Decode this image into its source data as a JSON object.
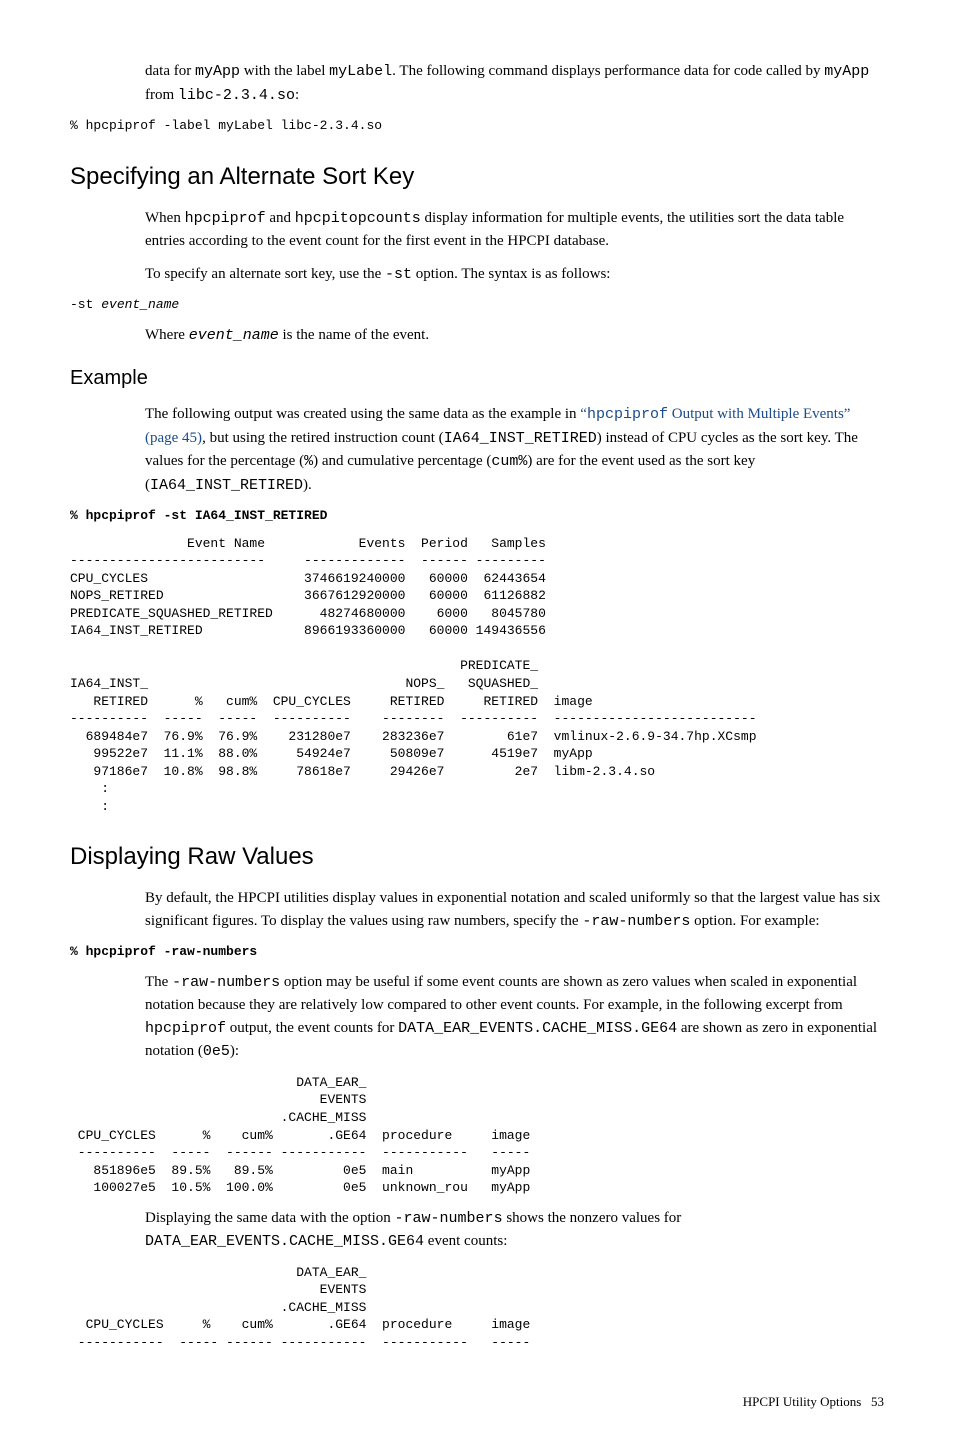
{
  "intro": {
    "p1_a": "data for ",
    "p1_b": "myApp",
    "p1_c": " with the label ",
    "p1_d": "myLabel",
    "p1_e": ". The following command displays performance data for code called by ",
    "p1_f": "myApp",
    "p1_g": " from ",
    "p1_h": "libc-2.3.4.so",
    "p1_i": ":",
    "code1": "% hpcpiprof -label myLabel libc-2.3.4.so"
  },
  "sortkey": {
    "heading": "Specifying an Alternate Sort Key",
    "p1_a": "When ",
    "p1_b": "hpcpiprof",
    "p1_c": " and ",
    "p1_d": "hpcpitopcounts",
    "p1_e": " display information for multiple events, the utilities sort the data table entries according to the event count for the first event in the HPCPI database.",
    "p2_a": "To specify an alternate sort key, use the ",
    "p2_b": "-st",
    "p2_c": " option. The syntax is as follows:",
    "code_a": "-st ",
    "code_b": "event_name",
    "p3_a": "Where ",
    "p3_b": "event_name",
    "p3_c": " is the name of the event."
  },
  "example": {
    "heading": "Example",
    "p1_a": "The following output was created using the same data as the example in ",
    "p1_link_a": "“",
    "p1_link_b": "hpcpiprof",
    "p1_link_c": " Output with Multiple Events” (page 45)",
    "p1_b": ", but using the retired instruction count (",
    "p1_c": "IA64_INST_RETIRED",
    "p1_d": ") instead of CPU cycles as the sort key. The values for the percentage (",
    "p1_e": "%",
    "p1_f": ") and cumulative percentage (",
    "p1_g": "cum%",
    "p1_h": ") are for the event used as the sort key (",
    "p1_i": "IA64_INST_RETIRED",
    "p1_j": ").",
    "cmd": "% hpcpiprof -st IA64_INST_RETIRED",
    "out": "               Event Name            Events  Period   Samples\n-------------------------     -------------  ------ ---------\nCPU_CYCLES                    3746619240000   60000  62443654\nNOPS_RETIRED                  3667612920000   60000  61126882\nPREDICATE_SQUASHED_RETIRED      48274680000    6000   8045780\nIA64_INST_RETIRED             8966193360000   60000 149436556\n\n                                                  PREDICATE_\nIA64_INST_                                 NOPS_   SQUASHED_\n   RETIRED      %   cum%  CPU_CYCLES     RETIRED     RETIRED  image\n----------  -----  -----  ----------    --------  ----------  --------------------------\n  689484e7  76.9%  76.9%    231280e7    283236e7        61e7  vmlinux-2.6.9-34.7hp.XCsmp\n   99522e7  11.1%  88.0%     54924e7     50809e7      4519e7  myApp\n   97186e7  10.8%  98.8%     78618e7     29426e7         2e7  libm-2.3.4.so\n    :\n    :"
  },
  "raw": {
    "heading": "Displaying Raw Values",
    "p1_a": "By default, the HPCPI utilities display values in exponential notation and scaled uniformly so that the largest value has six significant figures. To display the values using raw numbers, specify the ",
    "p1_b": "-raw-numbers",
    "p1_c": " option. For example:",
    "cmd": "% hpcpiprof -raw-numbers",
    "p2_a": "The ",
    "p2_b": "-raw-numbers",
    "p2_c": " option may be useful if some event counts are shown as zero values when scaled in exponential notation because they are relatively low compared to other event counts. For example, in the following excerpt from ",
    "p2_d": "hpcpiprof",
    "p2_e": " output, the event counts for ",
    "p2_f": "DATA_EAR_EVENTS.CACHE_MISS.GE64",
    "p2_g": " are shown as zero in exponential notation (",
    "p2_h": "0e5",
    "p2_i": "):",
    "out1": "                             DATA_EAR_\n                                EVENTS\n                           .CACHE_MISS\n CPU_CYCLES      %    cum%       .GE64  procedure     image\n ----------  -----  ------ -----------  -----------   -----\n   851896e5  89.5%   89.5%         0e5  main          myApp\n   100027e5  10.5%  100.0%         0e5  unknown_rou   myApp",
    "p3_a": "Displaying the same data with the option ",
    "p3_b": "-raw-numbers",
    "p3_c": " shows the nonzero values for ",
    "p3_d": "DATA_EAR_EVENTS.CACHE_MISS.GE64",
    "p3_e": " event counts:",
    "out2": "                             DATA_EAR_\n                                EVENTS\n                           .CACHE_MISS\n  CPU_CYCLES     %    cum%       .GE64  procedure     image\n -----------  ----- ------ -----------  -----------   -----"
  },
  "footer": {
    "label": "HPCPI Utility Options",
    "page": "53"
  },
  "chart_data": {
    "type": "table",
    "tables": [
      {
        "title": "Event summary",
        "columns": [
          "Event Name",
          "Events",
          "Period",
          "Samples"
        ],
        "rows": [
          [
            "CPU_CYCLES",
            3746619240000,
            60000,
            62443654
          ],
          [
            "NOPS_RETIRED",
            3667612920000,
            60000,
            61126882
          ],
          [
            "PREDICATE_SQUASHED_RETIRED",
            48274680000,
            6000,
            8045780
          ],
          [
            "IA64_INST_RETIRED",
            8966193360000,
            60000,
            149436556
          ]
        ]
      },
      {
        "title": "Per-image breakdown sorted by IA64_INST_RETIRED",
        "columns": [
          "IA64_INST_RETIRED",
          "%",
          "cum%",
          "CPU_CYCLES",
          "NOPS_RETIRED",
          "PREDICATE_SQUASHED_RETIRED",
          "image"
        ],
        "rows": [
          [
            "689484e7",
            "76.9%",
            "76.9%",
            "231280e7",
            "283236e7",
            "61e7",
            "vmlinux-2.6.9-34.7hp.XCsmp"
          ],
          [
            "99522e7",
            "11.1%",
            "88.0%",
            "54924e7",
            "50809e7",
            "4519e7",
            "myApp"
          ],
          [
            "97186e7",
            "10.8%",
            "98.8%",
            "78618e7",
            "29426e7",
            "2e7",
            "libm-2.3.4.so"
          ]
        ]
      },
      {
        "title": "Exponential notation excerpt",
        "columns": [
          "CPU_CYCLES",
          "%",
          "cum%",
          "DATA_EAR_EVENTS.CACHE_MISS.GE64",
          "procedure",
          "image"
        ],
        "rows": [
          [
            "851896e5",
            "89.5%",
            "89.5%",
            "0e5",
            "main",
            "myApp"
          ],
          [
            "100027e5",
            "10.5%",
            "100.0%",
            "0e5",
            "unknown_rou",
            "myApp"
          ]
        ]
      }
    ]
  }
}
